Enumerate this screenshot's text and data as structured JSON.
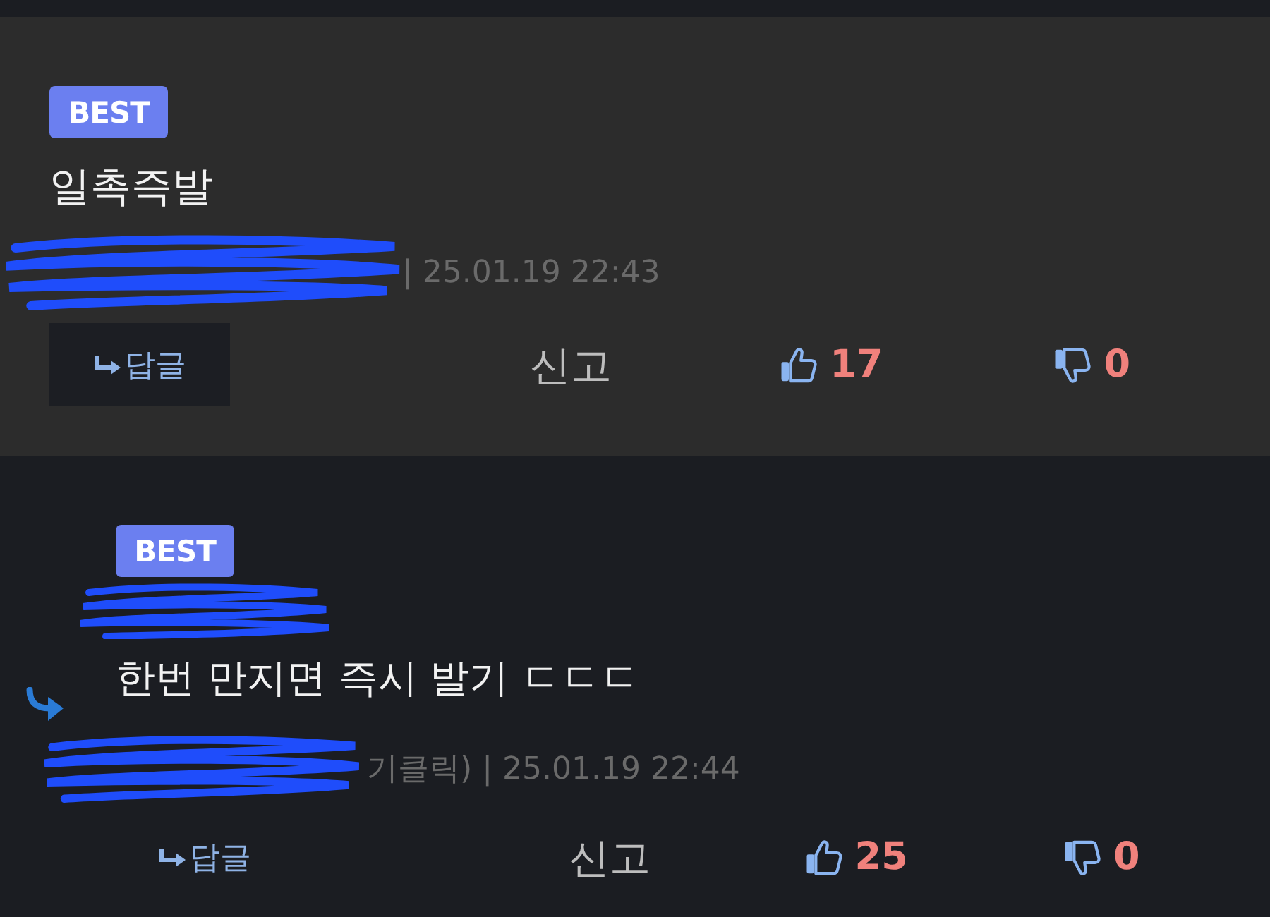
{
  "comments": [
    {
      "kind": "comment",
      "selected": true,
      "badge": "BEST",
      "text": "일촉즉발",
      "meta": "| 25.01.19 22:43",
      "reply_label": "답글",
      "report_label": "신고",
      "likes": "17",
      "dislikes": "0"
    },
    {
      "kind": "reply",
      "selected": false,
      "badge": "BEST",
      "text": "한번 만지면 즉시 발기 ㄷㄷㄷ",
      "meta": "기클릭) | 25.01.19 22:44",
      "reply_label": "답글",
      "report_label": "신고",
      "likes": "25",
      "dislikes": "0"
    }
  ]
}
